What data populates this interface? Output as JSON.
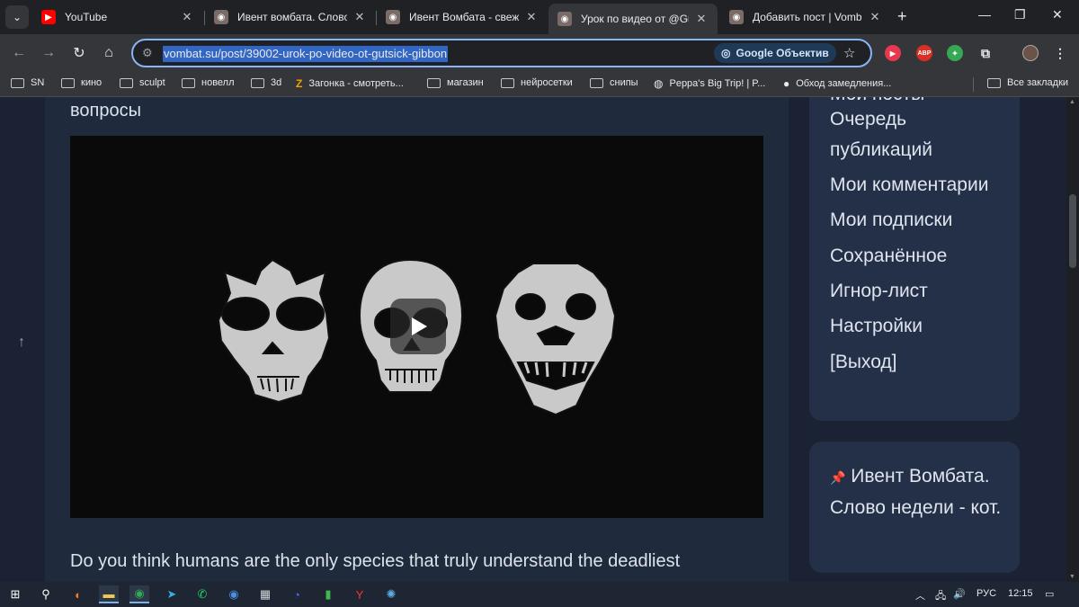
{
  "browser": {
    "tabs": [
      {
        "title": "YouTube",
        "icon": "youtube-icon",
        "active": false
      },
      {
        "title": "Ивент вомбата. Слово н",
        "icon": "wombat-favicon",
        "active": false
      },
      {
        "title": "Ивент Вомбата - свежие",
        "icon": "wombat-favicon",
        "active": false
      },
      {
        "title": "Урок по видео от @Guts",
        "icon": "wombat-favicon",
        "active": true
      },
      {
        "title": "Добавить пост | Vombat",
        "icon": "wombat-favicon",
        "active": false
      }
    ],
    "new_tab_label": "+",
    "address": "vombat.su/post/39002-urok-po-video-ot-gutsick-gibbon",
    "lens_label": "Google Объектив",
    "extensions": [
      {
        "name": "media-extension-icon",
        "color": "#e8384f",
        "text": "▶"
      },
      {
        "name": "adblock-icon",
        "color": "#d93025",
        "text": "ABP"
      },
      {
        "name": "colorful-extension-icon",
        "color": "#34a853",
        "text": "✦"
      }
    ]
  },
  "bookmarks": {
    "items": [
      {
        "label": "SN",
        "icon": "folder-icon"
      },
      {
        "label": "кино",
        "icon": "folder-icon"
      },
      {
        "label": "sculpt",
        "icon": "folder-icon"
      },
      {
        "label": "новелл",
        "icon": "folder-icon"
      },
      {
        "label": "3d",
        "icon": "folder-icon"
      },
      {
        "label": "Загонка - смотреть...",
        "icon": "zagonka-icon"
      },
      {
        "label": "магазин",
        "icon": "folder-icon"
      },
      {
        "label": "нейросетки",
        "icon": "folder-icon"
      },
      {
        "label": "снипы",
        "icon": "folder-icon"
      },
      {
        "label": "Peppa's Big Trip! | P...",
        "icon": "globe-icon"
      },
      {
        "label": "Обход замедления...",
        "icon": "github-icon"
      }
    ],
    "all_bookmarks_label": "Все закладки"
  },
  "post": {
    "heading_fragment": "вопросы",
    "body_text": "Do you think humans are the only species that truly understand the deadliest"
  },
  "sidebar": {
    "menu": [
      "Мои посты",
      "Очередь публикаций",
      "Мои комментарии",
      "Мои подписки",
      "Сохранённое",
      "Игнор-лист",
      "Настройки",
      "[Выход]"
    ],
    "pinned_icon": "📌",
    "pinned_text": "Ивент Вомбата. Слово недели - кот."
  },
  "taskbar": {
    "apps": [
      "start-icon",
      "search-icon",
      "blender-icon",
      "file-explorer-icon",
      "chrome-icon",
      "telegram-icon",
      "whatsapp-icon",
      "chrome-alt-icon",
      "calculator-icon",
      "discord-icon",
      "app-icon",
      "yandex-icon",
      "krita-icon"
    ],
    "language": "РУС",
    "time": "12:15"
  }
}
